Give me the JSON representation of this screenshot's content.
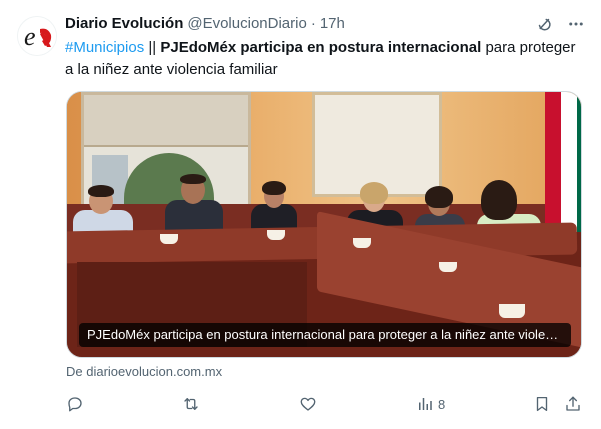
{
  "post": {
    "author_name": "Diario Evolución",
    "author_handle": "@EvolucionDiario",
    "separator": "·",
    "time": "17h",
    "avatar_letter": "e",
    "text": {
      "hashtag": "#Municipios",
      "divider": " || ",
      "bold_part": "PJEdoMéx participa en postura internacional",
      "rest": " para proteger a la niñez ante violencia familiar"
    },
    "media": {
      "caption": "PJEdoMéx participa en postura internacional para proteger a la niñez ante violencia familiar"
    },
    "source": "De diarioevolucion.com.mx",
    "stats": {
      "views": "8"
    }
  },
  "icons": {
    "grok": "grok-icon",
    "more": "more-icon",
    "reply": "reply-icon",
    "repost": "repost-icon",
    "like": "like-icon",
    "views": "views-icon",
    "bookmark": "bookmark-icon",
    "share": "share-icon"
  },
  "colors": {
    "link": "#1d9bf0",
    "text": "#0f1419",
    "muted": "#536471",
    "avatar_accent": "#d7191c"
  }
}
